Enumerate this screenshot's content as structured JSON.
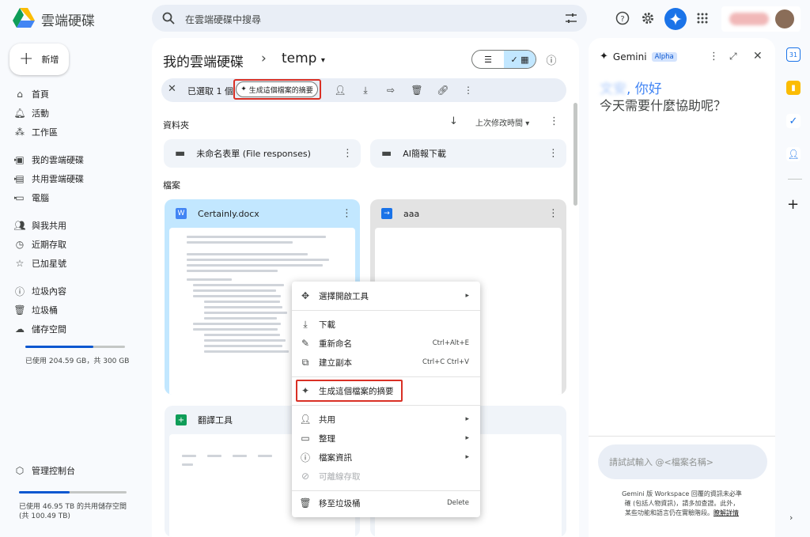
{
  "app": {
    "brand": "雲端硬碟"
  },
  "search": {
    "placeholder": "在雲端硬碟中搜尋"
  },
  "sidebar": {
    "new_label": "新增",
    "items": [
      {
        "label": "首頁",
        "icon": "home-icon"
      },
      {
        "label": "活動",
        "icon": "bell-icon"
      },
      {
        "label": "工作區",
        "icon": "workspaces-icon"
      },
      {
        "label": "我的雲端硬碟",
        "icon": "my-drive-icon"
      },
      {
        "label": "共用雲端硬碟",
        "icon": "shared-drives-icon"
      },
      {
        "label": "電腦",
        "icon": "computer-icon"
      },
      {
        "label": "與我共用",
        "icon": "people-icon"
      },
      {
        "label": "近期存取",
        "icon": "clock-icon"
      },
      {
        "label": "已加星號",
        "icon": "star-icon"
      },
      {
        "label": "垃圾內容",
        "icon": "spam-icon"
      },
      {
        "label": "垃圾桶",
        "icon": "trash-icon"
      },
      {
        "label": "儲存空間",
        "icon": "cloud-icon"
      }
    ],
    "storage_text": "已使用 204.59 GB，共 300 GB",
    "storage_used_fraction": 0.68,
    "admin_label": "管理控制台",
    "shared_storage_text_1": "已使用 46.95 TB 的共用儲存空間",
    "shared_storage_text_2": "(共 100.49 TB)",
    "shared_storage_fraction": 0.47
  },
  "main": {
    "breadcrumb_root": "我的雲端硬碟",
    "breadcrumb_sep": "›",
    "breadcrumb_current": "temp",
    "selection_text": "已選取 1 個",
    "summary_chip": "生成這個檔案的摘要",
    "folders_heading": "資料夾",
    "sort_label": "上次修改時間",
    "folders": [
      {
        "name": "未命名表單 (File responses)"
      },
      {
        "name": "AI簡報下載"
      }
    ],
    "files_heading": "檔案",
    "files": [
      {
        "name": "Certainly.docx",
        "badge": "W"
      },
      {
        "name": "aaa",
        "badge": "→"
      },
      {
        "name": "翻譯工具",
        "badge": "+"
      }
    ]
  },
  "context_menu": {
    "items": [
      {
        "label": "選擇開啟工具",
        "icon": "open-with-icon",
        "shortcut": "",
        "submenu": true
      },
      {
        "label": "下載",
        "icon": "download-icon",
        "shortcut": "",
        "submenu": false
      },
      {
        "label": "重新命名",
        "icon": "rename-icon",
        "shortcut": "Ctrl+Alt+E",
        "submenu": false
      },
      {
        "label": "建立副本",
        "icon": "copy-icon",
        "shortcut": "Ctrl+C Ctrl+V",
        "submenu": false
      },
      {
        "label": "生成這個檔案的摘要",
        "icon": "sparkle-icon",
        "shortcut": "",
        "submenu": false
      },
      {
        "label": "共用",
        "icon": "share-icon",
        "shortcut": "",
        "submenu": true
      },
      {
        "label": "整理",
        "icon": "folder-icon",
        "shortcut": "",
        "submenu": true
      },
      {
        "label": "檔案資訊",
        "icon": "info-icon",
        "shortcut": "",
        "submenu": true
      },
      {
        "label": "可離線存取",
        "icon": "offline-icon",
        "shortcut": "",
        "submenu": false,
        "disabled": true
      },
      {
        "label": "移至垃圾桶",
        "icon": "trash-icon",
        "shortcut": "Delete",
        "submenu": false
      }
    ]
  },
  "gemini": {
    "title": "Gemini",
    "badge": "Alpha",
    "greeting_name": "文安",
    "greeting_suffix": ", 你好",
    "prompt": "今天需要什麼協助呢？",
    "input_placeholder": "請試試輸入 @<檔案名稱>",
    "disclaimer_1": "Gemini 版 Workspace 回覆的資訊未必準",
    "disclaimer_2": "確 (包括人物資訊)，請多加查證。此外，",
    "disclaimer_3": "某些功能和語言仍在實驗階段。",
    "learn_more": "瞭解詳情"
  },
  "colors": {
    "accent": "#0b57d0",
    "highlight_red": "#d93025",
    "selected_card": "#c2e7ff"
  }
}
